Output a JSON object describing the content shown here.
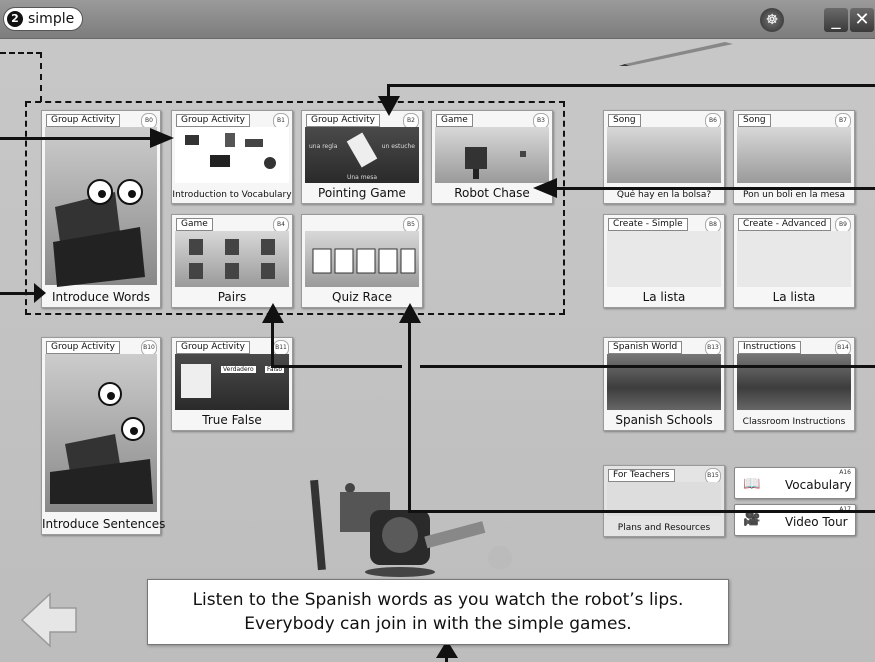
{
  "app": {
    "logo_num": "2",
    "logo_text": "simple"
  },
  "window_controls": {
    "minimize": "_",
    "close": "✕",
    "settings": "☸"
  },
  "group1": [
    {
      "tag": "Group Activity",
      "num": "B0",
      "caption": "Introduce Words"
    },
    {
      "tag": "Group Activity",
      "num": "B1",
      "caption": "Introduction to Vocabulary"
    },
    {
      "tag": "Group Activity",
      "num": "B2",
      "caption": "Pointing Game",
      "pic_left": "una regla",
      "pic_right": "un estuche",
      "pic_bottom": "Una mesa"
    },
    {
      "tag": "Game",
      "num": "B3",
      "caption": "Robot Chase"
    },
    {
      "tag": "Game",
      "num": "B4",
      "caption": "Pairs"
    },
    {
      "tag": "",
      "num": "B5",
      "caption": "Quiz Race"
    }
  ],
  "group2": [
    {
      "tag": "Group Activity",
      "num": "B10",
      "caption": "Introduce Sentences"
    },
    {
      "tag": "Group Activity",
      "num": "B11",
      "caption": "True False",
      "pic_left": "Verdadero",
      "pic_right": "Falso"
    }
  ],
  "right_cards": [
    {
      "tag": "Song",
      "num": "B6",
      "caption": "Qué hay en la bolsa?"
    },
    {
      "tag": "Song",
      "num": "B7",
      "caption": "Pon un boli en la mesa"
    },
    {
      "tag": "Create - Simple",
      "num": "B8",
      "caption": "La lista"
    },
    {
      "tag": "Create - Advanced",
      "num": "B9",
      "caption": "La lista"
    },
    {
      "tag": "Spanish World",
      "num": "B13",
      "caption": "Spanish Schools"
    },
    {
      "tag": "Instructions",
      "num": "B14",
      "caption": "Classroom Instructions"
    },
    {
      "tag": "For Teachers",
      "num": "B15",
      "caption": "Plans and Resources"
    }
  ],
  "links": [
    {
      "label": "Vocabulary",
      "num": "A16"
    },
    {
      "label": "Video Tour",
      "num": "A17"
    }
  ],
  "message": {
    "line1": "Listen to the Spanish words as you watch the robot’s lips.",
    "line2": "Everybody can join in with the simple games."
  },
  "colors": {
    "background": "#c4c4c4",
    "accent": "#111111",
    "card": "#f6f6f6"
  }
}
